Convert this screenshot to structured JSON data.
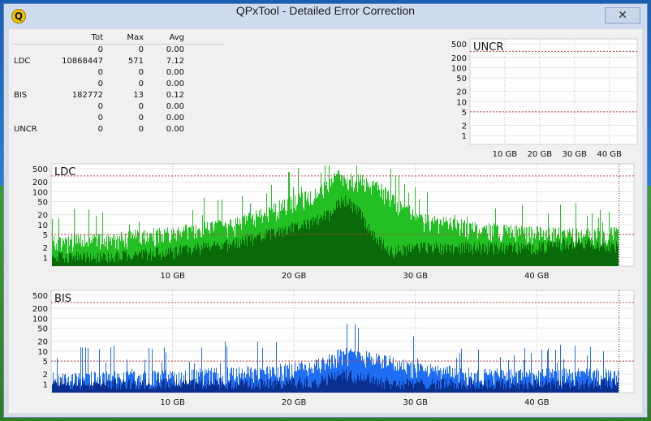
{
  "window": {
    "title": "QPxTool - Detailed Error Correction",
    "icon_letter": "Q",
    "close_glyph": "✕"
  },
  "stats": {
    "headers": [
      "",
      "Tot",
      "Max",
      "Avg"
    ],
    "rows": [
      [
        "",
        "0",
        "0",
        "0.00"
      ],
      [
        "LDC",
        "10868447",
        "571",
        "7.12"
      ],
      [
        "",
        "0",
        "0",
        "0.00"
      ],
      [
        "",
        "0",
        "0",
        "0.00"
      ],
      [
        "BIS",
        "182772",
        "13",
        "0.12"
      ],
      [
        "",
        "0",
        "0",
        "0.00"
      ],
      [
        "",
        "0",
        "0",
        "0.00"
      ],
      [
        "UNCR",
        "0",
        "0",
        "0.00"
      ]
    ]
  },
  "colors": {
    "ldc_light": "#22c022",
    "ldc_dark": "#0a6a0a",
    "bis_light": "#1f6df2",
    "bis_dark": "#0a2f8f",
    "threshold": "#c04040"
  },
  "chart_data": [
    {
      "name": "UNCR-chart",
      "type": "bar",
      "label": "UNCR",
      "scale": "log",
      "yticks": [
        500,
        200,
        100,
        50,
        20,
        10,
        5,
        2,
        1
      ],
      "xticks": [
        10,
        20,
        30,
        40
      ],
      "xtick_unit": "GB",
      "xlim": [
        0,
        48
      ],
      "thresholds": [
        300,
        5
      ],
      "values": []
    },
    {
      "name": "LDC-chart",
      "type": "bar",
      "label": "LDC",
      "scale": "log",
      "yticks": [
        500,
        200,
        100,
        50,
        20,
        10,
        5,
        2,
        1
      ],
      "xticks": [
        10,
        20,
        30,
        40
      ],
      "xtick_unit": "GB",
      "xlim": [
        0,
        48
      ],
      "thresholds": [
        300,
        5
      ],
      "data_end": 46.7,
      "envelope": {
        "x": [
          0,
          5,
          10,
          15,
          18,
          21,
          23,
          23.6,
          24,
          25,
          26,
          27,
          28,
          30,
          35,
          40,
          44,
          46.7
        ],
        "light": [
          3,
          4,
          6,
          10,
          25,
          70,
          170,
          320,
          280,
          240,
          200,
          130,
          60,
          15,
          8,
          6,
          5,
          6
        ],
        "dark": [
          1,
          1,
          1.5,
          2.5,
          5,
          10,
          20,
          40,
          60,
          30,
          8,
          3,
          1.5,
          2,
          2,
          2,
          3,
          2
        ]
      }
    },
    {
      "name": "BIS-chart",
      "type": "bar",
      "label": "BIS",
      "scale": "log",
      "yticks": [
        500,
        200,
        100,
        50,
        20,
        10,
        5,
        2,
        1
      ],
      "xticks": [
        10,
        20,
        30,
        40
      ],
      "xtick_unit": "GB",
      "xlim": [
        0,
        48
      ],
      "thresholds": [
        300,
        5
      ],
      "data_end": 46.7,
      "envelope": {
        "x": [
          0,
          10,
          18,
          22,
          24,
          26,
          28,
          30,
          35,
          40,
          46.7
        ],
        "light": [
          1.5,
          1.8,
          2.5,
          4,
          9,
          7,
          5,
          3,
          2,
          2,
          2
        ],
        "dark": [
          1,
          1,
          1,
          1.2,
          2,
          1.5,
          1,
          1,
          1,
          1,
          1
        ]
      }
    }
  ]
}
